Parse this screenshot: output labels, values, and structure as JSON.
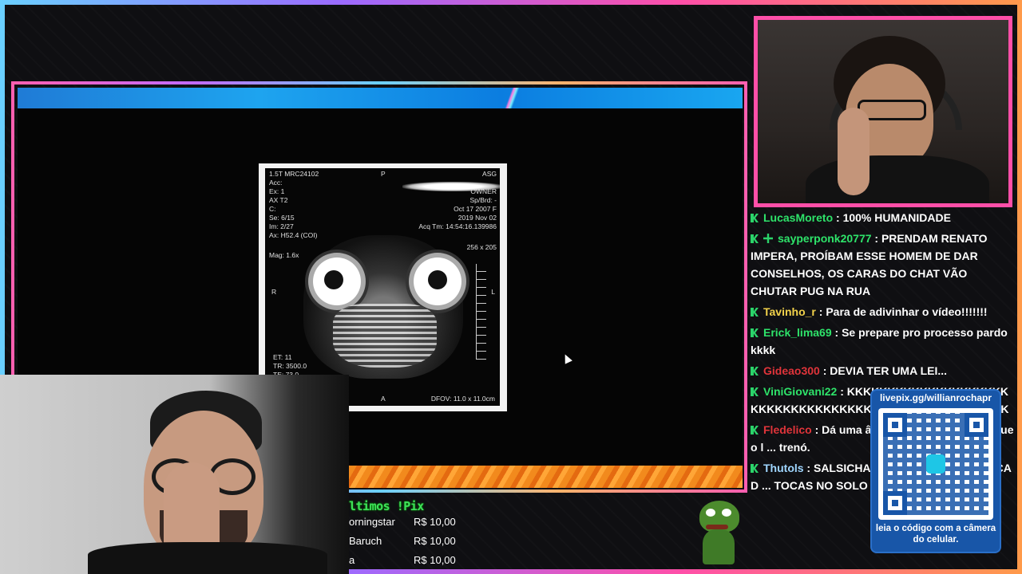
{
  "colors": {
    "accent_pink": "#ff4fa8",
    "topbar_blue": "#1ea4ef",
    "bottombar_orange": "#f28a1d",
    "badge_green": "#2bd46a",
    "qr_blue": "#1856a8"
  },
  "mri": {
    "top_left": "1.5T MRC24102\nAcc:\nEx: 1\nAX T2\nC:\nSe: 6/15\nIm: 2/27\nAx: H52.4 (COI)",
    "mag": "Mag: 1.6x",
    "top_center": "P",
    "top_right": "ASG\n\nOWNER\nSp/Brd: -\nOct 17 2007 F\n2019 Nov 02\nAcq Tm: 14:54:16.139986",
    "matrix": "256 x 205",
    "side_left": "R",
    "side_right": "L",
    "bottom_left": "ET: 11\nTR: 3500.0\nTE: 73.0",
    "bottom_center": "A",
    "bottom_right": "DFOV: 11.0 x 11.0cm"
  },
  "chat": [
    {
      "user": "LucasMoreto",
      "color": "#2ee36a",
      "text": " : 100% HUMANIDADE",
      "extra_badge": false
    },
    {
      "user": "sayperponk20777",
      "color": "#2ee36a",
      "text": " : PRENDAM RENATO IMPERA, PROÍBAM ESSE HOMEM DE DAR CONSELHOS, OS CARAS DO CHAT VÃO CHUTAR PUG NA RUA",
      "extra_badge": true
    },
    {
      "user": "Tavinho_r",
      "color": "#f2d24b",
      "text": " : Para de adivinhar o vídeo!!!!!!!",
      "extra_badge": false
    },
    {
      "user": "Erick_lima69",
      "color": "#2ee36a",
      "text": " : Se prepare pro processo pardo kkkk",
      "extra_badge": false
    },
    {
      "user": "Gideao300",
      "color": "#e0343a",
      "text": " : DEVIA TER UMA LEI...",
      "extra_badge": false
    },
    {
      "user": "ViniGiovani22",
      "color": "#2ee36a",
      "text": " : KKKKKKKKKKKKKKKKKKKKKKKKKKKKKKKKKKKKKKKKKKKKKKKKKKKK",
      "extra_badge": false
    },
    {
      "user": "Fledelico",
      "color": "#e0343a",
      "text": " : Dá uma â ... sil. Caralho quando que o l ... trenó.",
      "extra_badge": false
    },
    {
      "user": "Thutols",
      "color": "#9fd6ff",
      "text": " : SALSICHA ... M CRIADOS PRA CAÇA D ... TOCAS NO SOLO",
      "extra_badge": false
    }
  ],
  "qr": {
    "url": "livepix.gg/willianrochapr",
    "caption": "leia o código com a câmera do celular."
  },
  "donors": {
    "title": "ltimos !Pix",
    "rows": [
      {
        "name": "orningstar",
        "amount": "R$ 10,00"
      },
      {
        "name": "Baruch",
        "amount": "R$ 10,00"
      },
      {
        "name": "a",
        "amount": "R$ 10,00"
      }
    ]
  },
  "icons": {
    "cursor": "cursor-arrow-icon",
    "badge": "kick-badge-icon",
    "emote": "pepe-emote-icon",
    "qr": "qr-code-icon"
  }
}
